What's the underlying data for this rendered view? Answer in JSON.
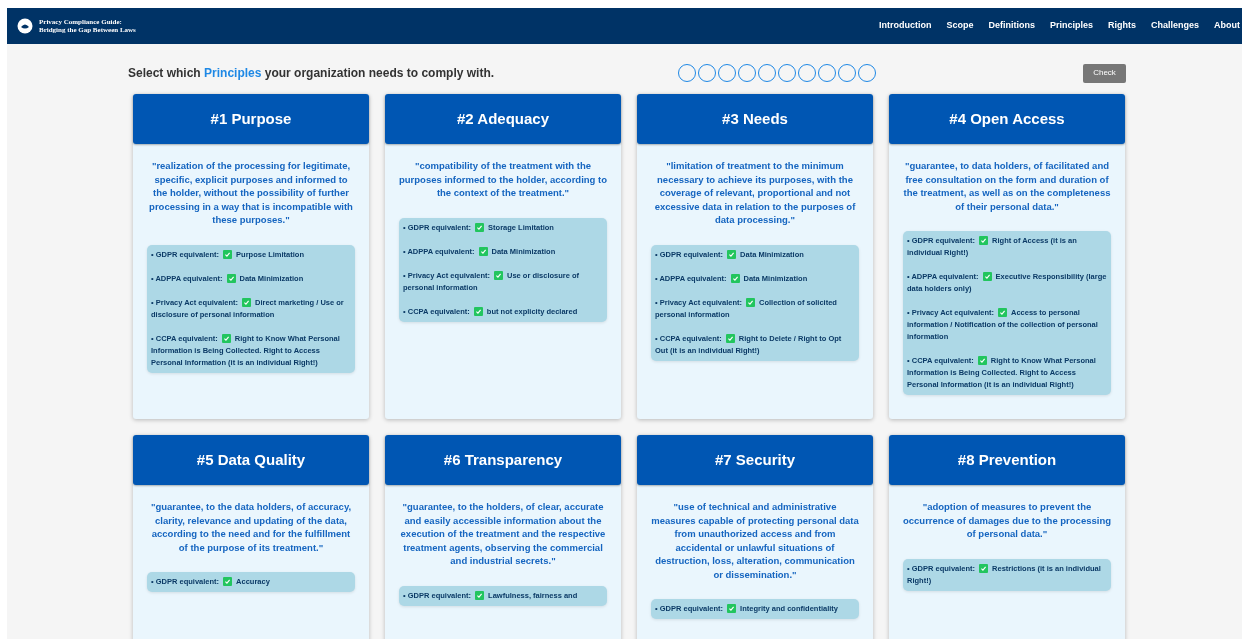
{
  "nav": {
    "brand": [
      "Privacy Compliance Guide:",
      "Bridging the Gap Between Laws"
    ],
    "links": [
      {
        "label": "Introduction",
        "selected": false
      },
      {
        "label": "Scope",
        "selected": false
      },
      {
        "label": "Definitions",
        "selected": false
      },
      {
        "label": "Principles",
        "selected": false
      },
      {
        "label": "Rights",
        "selected": false
      },
      {
        "label": "Challenges",
        "selected": false
      },
      {
        "label": "About",
        "selected": false
      }
    ]
  },
  "prompt": {
    "before": "Select which",
    "highlight": "Principles",
    "after": "your organization needs to comply with."
  },
  "answer_slots": [
    {
      "filled": false
    },
    {
      "filled": false
    },
    {
      "filled": false
    },
    {
      "filled": false
    },
    {
      "filled": false
    },
    {
      "filled": false
    },
    {
      "filled": false
    },
    {
      "filled": false
    },
    {
      "filled": false
    },
    {
      "filled": false
    }
  ],
  "check_button": "Check",
  "cards": [
    {
      "title": "#1 Purpose",
      "quote": "\"realization of the processing for legitimate, specific, explicit purposes and informed to the holder, without the possibility of further processing in a way that is incompatible with these purposes.\"",
      "items": [
        {
          "label": "• GDPR equivalent:",
          "checked": true,
          "value": "Purpose Limitation"
        },
        {
          "label": "• ADPPA equivalent:",
          "checked": true,
          "value": "Data Minimization"
        },
        {
          "label": "• Privacy Act equivalent:",
          "checked": true,
          "value": "Direct marketing / Use or disclosure of personal information"
        },
        {
          "label": "• CCPA equivalent:",
          "checked": true,
          "value": "Right to Know What Personal Information is Being Collected. Right to Access Personal Information (it is an individual Right!)"
        }
      ]
    },
    {
      "title": "#2 Adequacy",
      "quote": "\"compatibility of the treatment with the purposes informed to the holder, according to the context of the treatment.\"",
      "items": [
        {
          "label": "• GDPR equivalent:",
          "checked": true,
          "value": "Storage Limitation"
        },
        {
          "label": "• ADPPA equivalent:",
          "checked": true,
          "value": "Data Minimization"
        },
        {
          "label": "• Privacy Act equivalent:",
          "checked": true,
          "value": "Use or disclosure of personal information"
        },
        {
          "label": "• CCPA equivalent:",
          "checked": true,
          "value": "but not explicity declared"
        }
      ]
    },
    {
      "title": "#3 Needs",
      "quote": "\"limitation of treatment to the minimum necessary to achieve its purposes, with the coverage of relevant, proportional and not excessive data in relation to the purposes of data processing.\"",
      "items": [
        {
          "label": "• GDPR equivalent:",
          "checked": true,
          "value": "Data Minimization"
        },
        {
          "label": "• ADPPA equivalent:",
          "checked": true,
          "value": "Data Minimization"
        },
        {
          "label": "• Privacy Act equivalent:",
          "checked": true,
          "value": "Collection of solicited personal information"
        },
        {
          "label": "• CCPA equivalent:",
          "checked": true,
          "value": "Right to Delete / Right to Opt Out (it is an individual Right!)"
        }
      ]
    },
    {
      "title": "#4 Open Access",
      "quote": "\"guarantee, to data holders, of facilitated and free consultation on the form and duration of the treatment, as well as on the completeness of their personal data.\"",
      "items": [
        {
          "label": "• GDPR equivalent:",
          "checked": true,
          "value": "Right of Access (it is an individual Right!)"
        },
        {
          "label": "• ADPPA equivalent:",
          "checked": true,
          "value": "Executive Responsibility (large data holders only)"
        },
        {
          "label": "• Privacy Act equivalent:",
          "checked": true,
          "value": "Access to personal information / Notification of the collection of personal information"
        },
        {
          "label": "• CCPA equivalent:",
          "checked": true,
          "value": "Right to Know What Personal Information is Being Collected. Right to Access Personal Information (it is an individual Right!)"
        }
      ]
    },
    {
      "title": "#5 Data Quality",
      "quote": "\"guarantee, to the data holders, of accuracy, clarity, relevance and updating of the data, according to the need and for the fulfillment of the purpose of its treatment.\"",
      "items": [
        {
          "label": "• GDPR equivalent:",
          "checked": true,
          "value": "Accuracy"
        }
      ]
    },
    {
      "title": "#6 Transparency",
      "quote": "\"guarantee, to the holders, of clear, accurate and easily accessible information about the execution of the treatment and the respective treatment agents, observing the commercial and industrial secrets.\"",
      "items": [
        {
          "label": "• GDPR equivalent:",
          "checked": true,
          "value": "Lawfulness, fairness and"
        }
      ]
    },
    {
      "title": "#7 Security",
      "quote": "\"use of technical and administrative measures capable of protecting personal data from unauthorized access and from accidental or unlawful situations of destruction, loss, alteration, communication or dissemination.\"",
      "items": [
        {
          "label": "• GDPR equivalent:",
          "checked": true,
          "value": "Integrity and confidentiality"
        }
      ]
    },
    {
      "title": "#8 Prevention",
      "quote": "\"adoption of measures to prevent the occurrence of damages due to the processing of personal data.\"",
      "items": [
        {
          "label": "• GDPR equivalent:",
          "checked": true,
          "value": "Restrictions (it is an individual Right!)"
        }
      ]
    }
  ]
}
